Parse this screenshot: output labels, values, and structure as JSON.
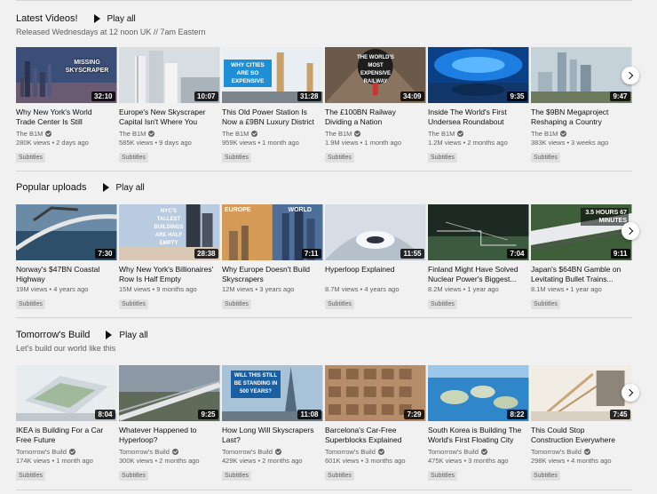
{
  "shelves": [
    {
      "title": "Latest Videos!",
      "play_all": "Play all",
      "subtitle": "Released Wednesdays at 12 noon UK // 7am Eastern",
      "videos": [
        {
          "title": "Why New York's World Trade Center Is Still Unfinished",
          "channel": "The B1M",
          "views": "280K views",
          "age": "2 days ago",
          "badge": "Subtitles",
          "duration": "32:10",
          "thumb_text": "MISSING SKYSCRAPER"
        },
        {
          "title": "Europe's New Skyscraper Capital Isn't Where You Think",
          "channel": "The B1M",
          "views": "585K views",
          "age": "9 days ago",
          "badge": "Subtitles",
          "duration": "10:07",
          "thumb_text": ""
        },
        {
          "title": "This Old Power Station Is Now a £9BN Luxury District",
          "channel": "The B1M",
          "views": "959K views",
          "age": "1 month ago",
          "badge": "Subtitles",
          "duration": "31:28",
          "thumb_text": "WHY CITIES ARE SO EXPENSIVE"
        },
        {
          "title": "The £100BN Railway Dividing a Nation",
          "channel": "The B1M",
          "views": "1.9M views",
          "age": "1 month ago",
          "badge": "Subtitles",
          "duration": "34:09",
          "thumb_text": "THE WORLD'S MOST EXPENSIVE RAILWAY"
        },
        {
          "title": "Inside The World's First Undersea Roundabout",
          "channel": "The B1M",
          "views": "1.2M views",
          "age": "2 months ago",
          "badge": "Subtitles",
          "duration": "9:35",
          "thumb_text": ""
        },
        {
          "title": "The $9BN Megaproject Reshaping a Country",
          "channel": "The B1M",
          "views": "383K views",
          "age": "3 weeks ago",
          "badge": "Subtitles",
          "duration": "9:47",
          "thumb_text": ""
        }
      ]
    },
    {
      "title": "Popular uploads",
      "play_all": "Play all",
      "subtitle": "",
      "videos": [
        {
          "title": "Norway's $47BN Coastal Highway",
          "channel": "",
          "views": "19M views",
          "age": "4 years ago",
          "badge": "Subtitles",
          "duration": "7:30",
          "thumb_text": ""
        },
        {
          "title": "Why New York's Billionaires' Row Is Half Empty",
          "channel": "",
          "views": "15M views",
          "age": "9 months ago",
          "badge": "Subtitles",
          "duration": "28:38",
          "thumb_text": "NYC'S TALLEST BUILDINGS ARE HALF EMPTY"
        },
        {
          "title": "Why Europe Doesn't Build Skyscrapers",
          "channel": "",
          "views": "12M views",
          "age": "3 years ago",
          "badge": "Subtitles",
          "duration": "7:11",
          "thumb_text": "EUROPE WORLD"
        },
        {
          "title": "Hyperloop Explained",
          "channel": "",
          "views": "8.7M views",
          "age": "4 years ago",
          "badge": "Subtitles",
          "duration": "11:55",
          "thumb_text": ""
        },
        {
          "title": "Finland Might Have Solved Nuclear Power's Biggest...",
          "channel": "",
          "views": "8.2M views",
          "age": "1 year ago",
          "badge": "Subtitles",
          "duration": "7:04",
          "thumb_text": ""
        },
        {
          "title": "Japan's $64BN Gamble on Levitating Bullet Trains...",
          "channel": "",
          "views": "8.1M views",
          "age": "1 year ago",
          "badge": "Subtitles",
          "duration": "9:11",
          "thumb_text": "3.5 HOURS 67 MINUTES"
        }
      ]
    },
    {
      "title": "Tomorrow's Build",
      "play_all": "Play all",
      "subtitle": "Let's build our world like this",
      "videos": [
        {
          "title": "IKEA is Building For a Car Free Future",
          "channel": "Tomorrow's Build",
          "views": "174K views",
          "age": "1 month ago",
          "badge": "Subtitles",
          "duration": "8:04",
          "thumb_text": ""
        },
        {
          "title": "Whatever Happened to Hyperloop?",
          "channel": "Tomorrow's Build",
          "views": "300K views",
          "age": "2 months ago",
          "badge": "Subtitles",
          "duration": "9:25",
          "thumb_text": ""
        },
        {
          "title": "How Long Will Skyscrapers Last?",
          "channel": "Tomorrow's Build",
          "views": "429K views",
          "age": "2 months ago",
          "badge": "Subtitles",
          "duration": "11:08",
          "thumb_text": "WILL THIS STILL BE STANDING IN 500 YEARS?"
        },
        {
          "title": "Barcelona's Car-Free Superblocks Explained",
          "channel": "Tomorrow's Build",
          "views": "601K views",
          "age": "3 months ago",
          "badge": "Subtitles",
          "duration": "7:29",
          "thumb_text": ""
        },
        {
          "title": "South Korea is Building The World's First Floating City",
          "channel": "Tomorrow's Build",
          "views": "475K views",
          "age": "3 months ago",
          "badge": "Subtitles",
          "duration": "8:22",
          "thumb_text": ""
        },
        {
          "title": "This Could Stop Construction Everywhere",
          "channel": "Tomorrow's Build",
          "views": "298K views",
          "age": "4 months ago",
          "badge": "Subtitles",
          "duration": "7:45",
          "thumb_text": ""
        }
      ]
    }
  ],
  "colors": {
    "background": "#f1f1f1",
    "badge_bg": "#e0e0e0",
    "meta_text": "#606060"
  },
  "icons": {
    "play_all": "play-icon",
    "next": "chevron-right-icon",
    "verified": "verified-check-icon"
  }
}
